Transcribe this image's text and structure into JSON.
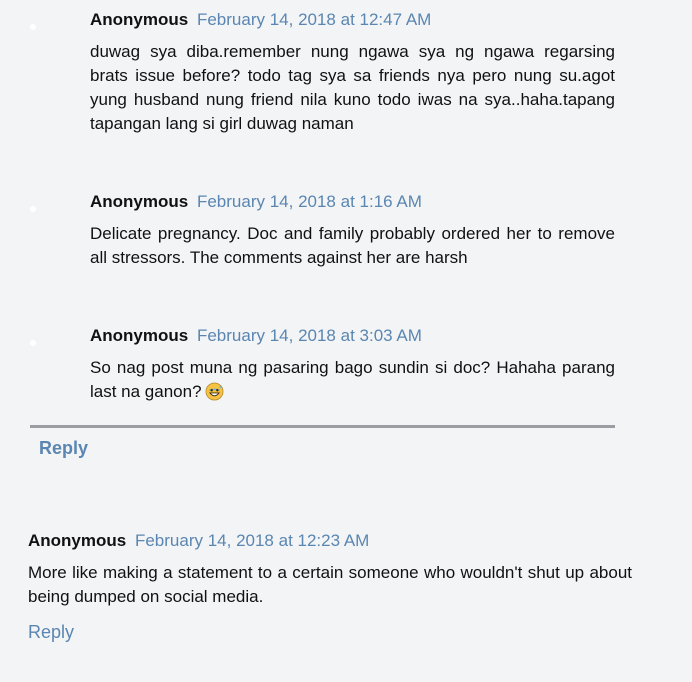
{
  "replies": [
    {
      "author": "Anonymous",
      "date": "February 14, 2018 at 12:47 AM",
      "text": "duwag sya diba.remember nung ngawa sya ng ngawa regarsing brats issue before? todo tag sya sa friends nya pero nung su.agot yung husband nung friend nila kuno todo iwas na sya..haha.tapang tapangan lang si girl duwag naman"
    },
    {
      "author": "Anonymous",
      "date": "February 14, 2018 at 1:16 AM",
      "text": "Delicate pregnancy. Doc and family probably ordered her to remove all stressors. The comments against her are harsh"
    },
    {
      "author": "Anonymous",
      "date": "February 14, 2018 at 3:03 AM",
      "text": "So nag post muna ng pasaring bago sundin si doc? Hahaha parang last na ganon?",
      "emoji": "grinning-sweat-emoji"
    }
  ],
  "thread_reply_label": "Reply",
  "top_comment": {
    "author": "Anonymous",
    "date": "February 14, 2018 at 12:23 AM",
    "text": "More like making a statement to a certain someone who wouldn't shut up about being dumped on social media.",
    "reply_label": "Reply"
  },
  "colors": {
    "background": "#f3f4f6",
    "link": "#5a86b1",
    "text": "#111111",
    "divider": "#9a9ea3"
  }
}
